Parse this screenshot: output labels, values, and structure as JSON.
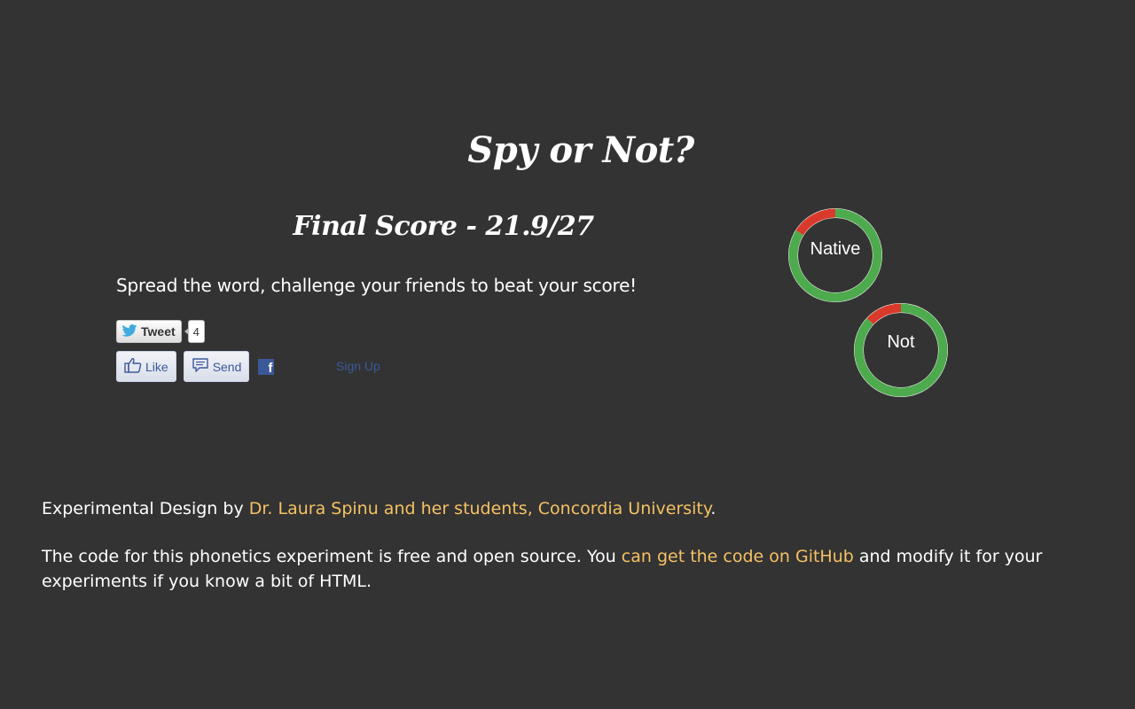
{
  "header": {
    "title": "Spy or Not?",
    "score": "Final Score - 21.9/27"
  },
  "share": {
    "prompt": "Spread the word, challenge your friends to beat your score!",
    "tweet_label": "Tweet",
    "tweet_count": "4",
    "like_label": "Like",
    "send_label": "Send",
    "facebook_glyph": "f",
    "signup_label": "Sign Up"
  },
  "results": {
    "native": {
      "label": "Native",
      "correct_fraction": 0.84
    },
    "not": {
      "label": "Not",
      "correct_fraction": 0.87
    },
    "colors": {
      "correct": "#4daa4d",
      "incorrect": "#d93a2b"
    }
  },
  "footer": {
    "credit_prefix": "Experimental Design by ",
    "credit_link": "Dr. Laura Spinu and her students, Concordia University",
    "credit_suffix": ".",
    "code_prefix": "The code for this phonetics experiment is free and open source. You ",
    "code_link": "can get the code on GitHub",
    "code_suffix": " and modify it for your experiments if you know a bit of HTML."
  }
}
